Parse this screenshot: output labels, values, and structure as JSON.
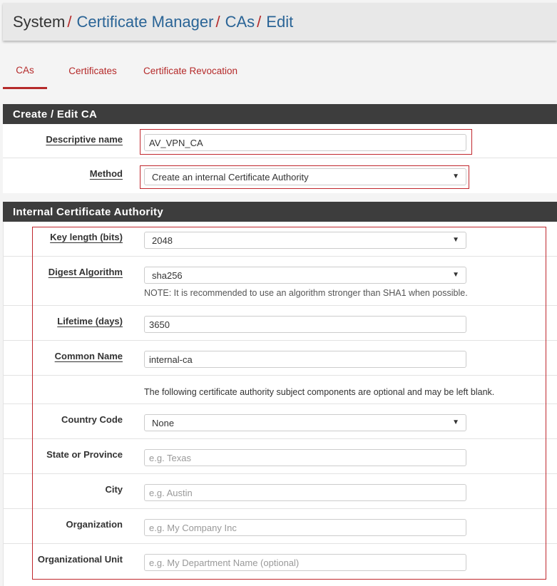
{
  "breadcrumb": {
    "items": [
      "System",
      "Certificate Manager",
      "CAs",
      "Edit"
    ],
    "separator": "/"
  },
  "tabs": [
    {
      "label": "CAs",
      "active": true
    },
    {
      "label": "Certificates",
      "active": false
    },
    {
      "label": "Certificate Revocation",
      "active": false
    }
  ],
  "create_section": {
    "title": "Create / Edit CA",
    "descriptive_name": {
      "label": "Descriptive name",
      "value": "AV_VPN_CA"
    },
    "method": {
      "label": "Method",
      "value": "Create an internal Certificate Authority"
    }
  },
  "internal_section": {
    "title": "Internal Certificate Authority",
    "key_length": {
      "label": "Key length (bits)",
      "value": "2048"
    },
    "digest": {
      "label": "Digest Algorithm",
      "value": "sha256",
      "note": "NOTE: It is recommended to use an algorithm stronger than SHA1 when possible."
    },
    "lifetime": {
      "label": "Lifetime (days)",
      "value": "3650"
    },
    "common_name": {
      "label": "Common Name",
      "value": "internal-ca"
    },
    "optional_note": "The following certificate authority subject components are optional and may be left blank.",
    "country": {
      "label": "Country Code",
      "value": "None"
    },
    "state": {
      "label": "State or Province",
      "placeholder": "e.g. Texas"
    },
    "city": {
      "label": "City",
      "placeholder": "e.g. Austin"
    },
    "organization": {
      "label": "Organization",
      "placeholder": "e.g. My Company Inc"
    },
    "org_unit": {
      "label": "Organizational Unit",
      "placeholder": "e.g. My Department Name (optional)"
    }
  },
  "colors": {
    "accent": "#b52a2a",
    "link": "#2a6496",
    "panel_heading": "#3d3d3d",
    "highlight_box": "#c0272d"
  },
  "icons": {
    "select_caret": "caret-down-icon"
  }
}
